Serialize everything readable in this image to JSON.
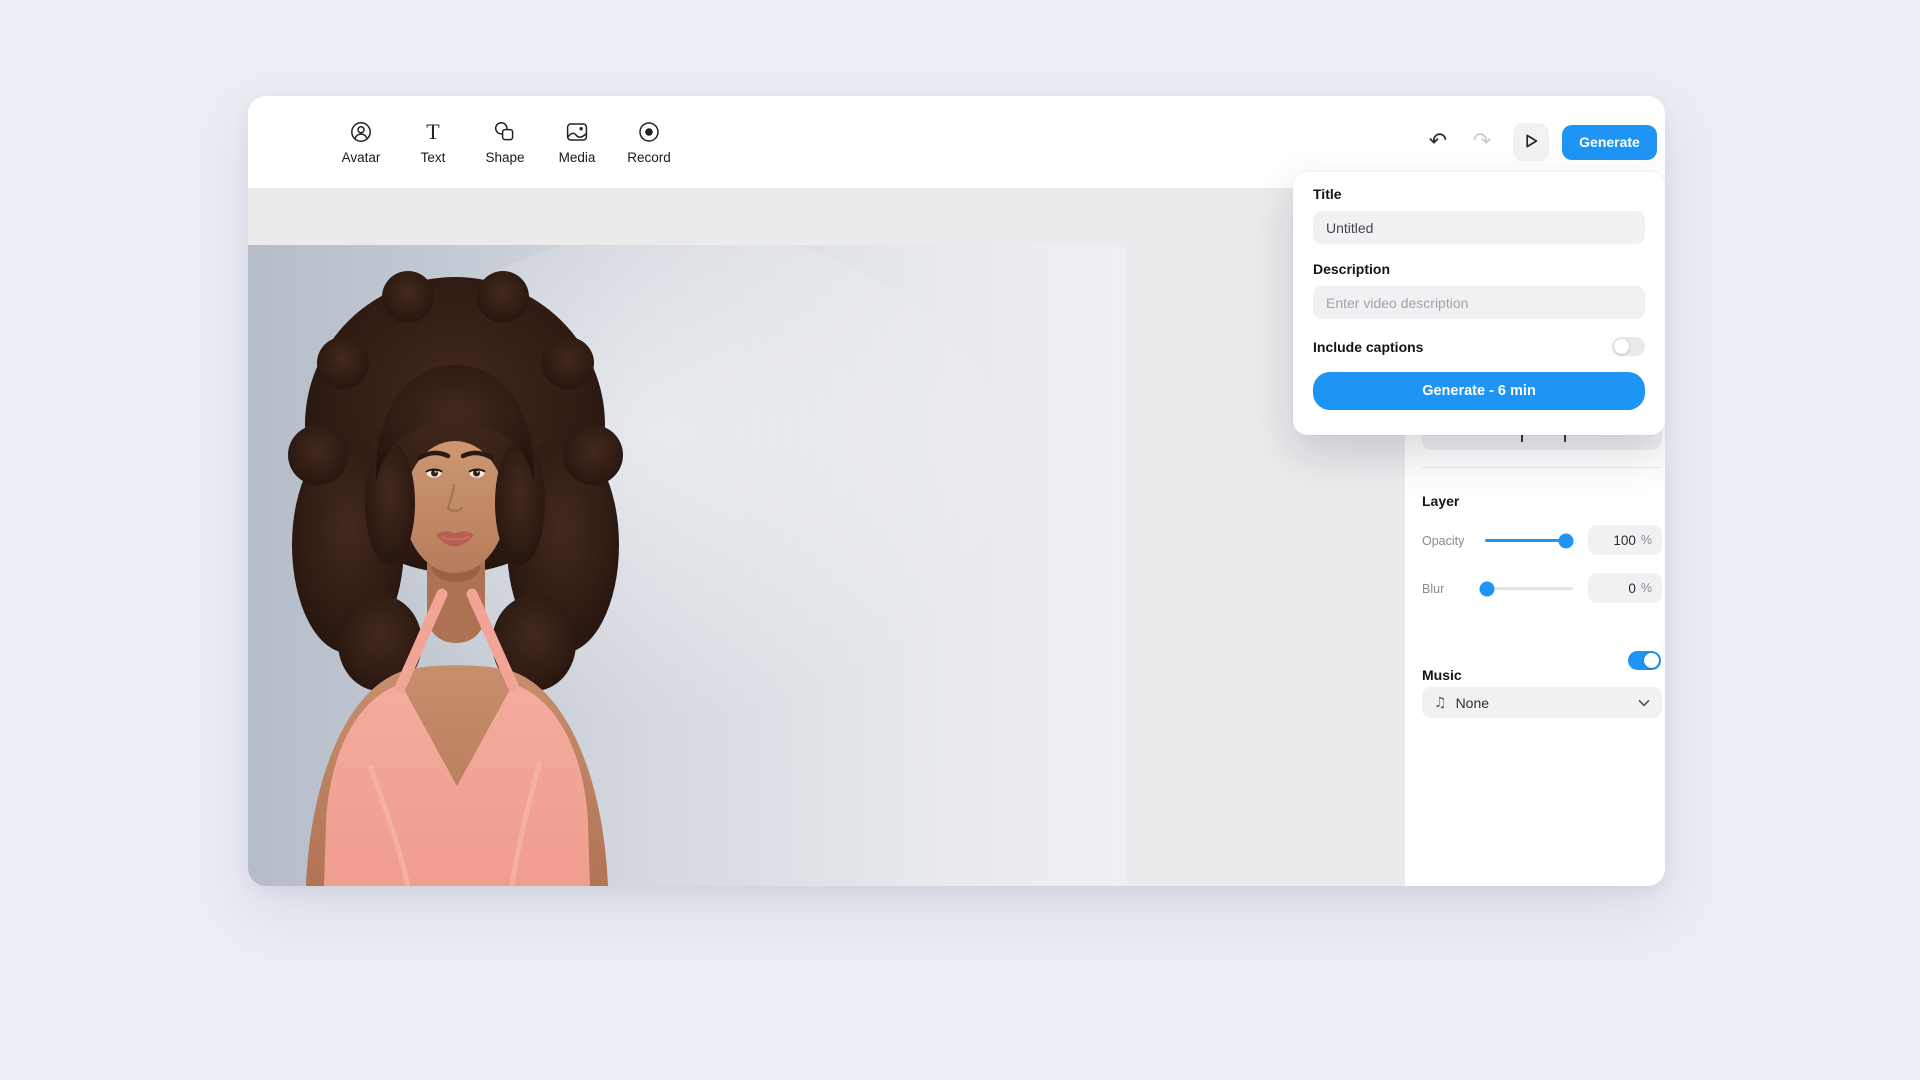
{
  "colors": {
    "accent": "#1e94f4",
    "page_bg": "#eceef6",
    "canvas_bg": "#ebebed",
    "input_bg": "#f1f1f3",
    "panel_bg": "#ffffff"
  },
  "icons": {
    "undo-icon": "↶",
    "redo-icon": "↷",
    "play-icon": "triangle-outline",
    "music-note-icon": "♫",
    "chevron-down-icon": "chevron-down",
    "avatar-icon": "person-in-circle",
    "text-icon": "serif-T",
    "shape-icon": "circle-and-square",
    "media-icon": "picture",
    "record-icon": "dot-in-circle"
  },
  "toolbar": {
    "tools": [
      {
        "icon": "avatar-icon",
        "label": "Avatar"
      },
      {
        "icon": "text-icon",
        "label": "Text"
      },
      {
        "icon": "shape-icon",
        "label": "Shape"
      },
      {
        "icon": "media-icon",
        "label": "Media"
      },
      {
        "icon": "record-icon",
        "label": "Record"
      }
    ],
    "generate_label": "Generate"
  },
  "popover": {
    "title_label": "Title",
    "title_value": "Untitled",
    "description_label": "Description",
    "description_placeholder": "Enter video description",
    "captions_label": "Include captions",
    "captions_enabled": false,
    "generate_cta": "Generate - 6 min"
  },
  "sidebar": {
    "layer": {
      "heading": "Layer",
      "opacity_label": "Opacity",
      "opacity_value": "100",
      "blur_label": "Blur",
      "blur_value": "0",
      "unit": "%"
    },
    "music": {
      "heading": "Music",
      "enabled": true,
      "selected": "None"
    }
  },
  "canvas": {
    "subject": "presenter-avatar"
  }
}
